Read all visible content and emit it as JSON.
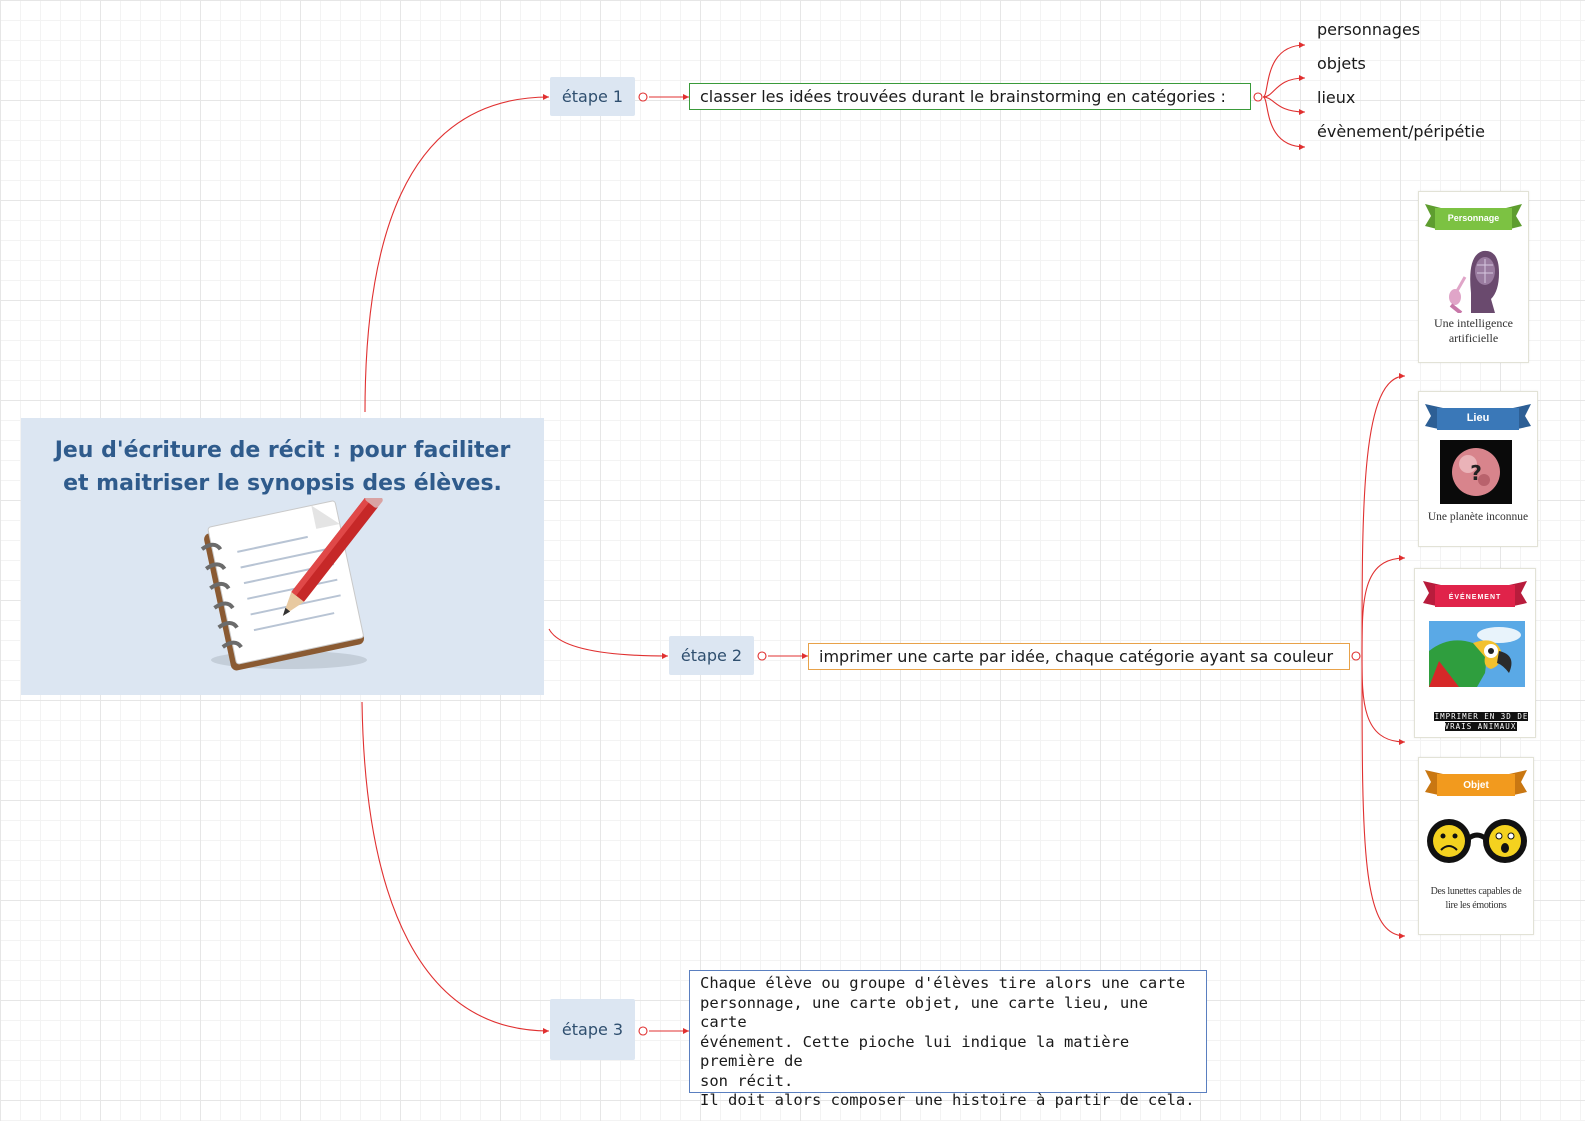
{
  "central": {
    "title": "Jeu d'écriture de récit : pour faciliter et maitriser le synopsis des élèves.",
    "icon": "notepad-pencil-icon"
  },
  "steps": [
    {
      "label": "étape 1",
      "text": "classer les idées trouvées durant le brainstorming en catégories :",
      "color": "#3a9a3a"
    },
    {
      "label": "étape 2",
      "text": "imprimer une carte par idée, chaque catégorie ayant sa couleur",
      "color": "#e8a24a"
    },
    {
      "label": "étape 3",
      "text": "Chaque élève ou groupe d'élèves tire alors une carte\npersonnage, une carte objet, une carte lieu, une carte\névénement. Cette pioche lui indique la matière première de\nson récit.\nIl doit alors composer une histoire à partir de cela.",
      "color": "#5a7fc0"
    }
  ],
  "categories": [
    "personnages",
    "objets",
    "lieux",
    "évènement/péripétie"
  ],
  "cards": [
    {
      "banner": "Personnage",
      "caption": "Une intelligence artificielle",
      "banner_color": "#7cc242",
      "picture": "robot-face-icon"
    },
    {
      "banner": "Lieu",
      "caption": "Une planète inconnue",
      "banner_color": "#3a78b8",
      "picture": "planet-question-icon"
    },
    {
      "banner": "ÉVÉNEMENT",
      "caption": "IMPRIMER EN 3D DE VRAIS ANIMAUX",
      "banner_color": "#e0234a",
      "picture": "parrot-icon"
    },
    {
      "banner": "Objet",
      "caption": "Des lunettes capables de lire les émotions",
      "banner_color": "#f29a1e",
      "picture": "emotion-glasses-icon"
    }
  ],
  "colors": {
    "connector": "#e03030",
    "central_fill": "#dce6f2",
    "title_text": "#2f5b8c"
  }
}
